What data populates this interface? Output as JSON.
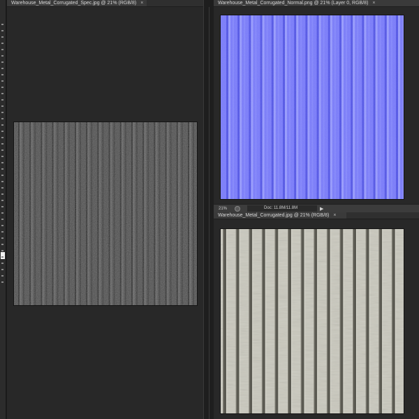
{
  "documents": {
    "spec": {
      "title": "Warehouse_Metal_Corrugated_Spec.jpg @ 21% (RGB/8)",
      "close": "×"
    },
    "normal": {
      "title": "Warehouse_Metal_Corrugated_Normal.png @ 21% (Layer 0, RGB/8)",
      "close": "×"
    },
    "diffuse": {
      "title": "Warehouse_Metal_Corrugated.jpg @ 21% (RGB/8)",
      "close": "×"
    }
  },
  "status_bar": {
    "zoom": "21%",
    "doc_info": "Doc: 11.8M/11.8M",
    "menu_arrow": "▶"
  },
  "colors": {
    "spec_base": "#4e4e4e",
    "normal_base": "#7b7dfc",
    "diffuse_base": "#c9c8bd",
    "panel_bg": "#282828",
    "tab_bg": "#3a3a3a"
  },
  "icons": {
    "status_icon": "circle-icon",
    "menu_arrow": "triangle-right-icon"
  }
}
